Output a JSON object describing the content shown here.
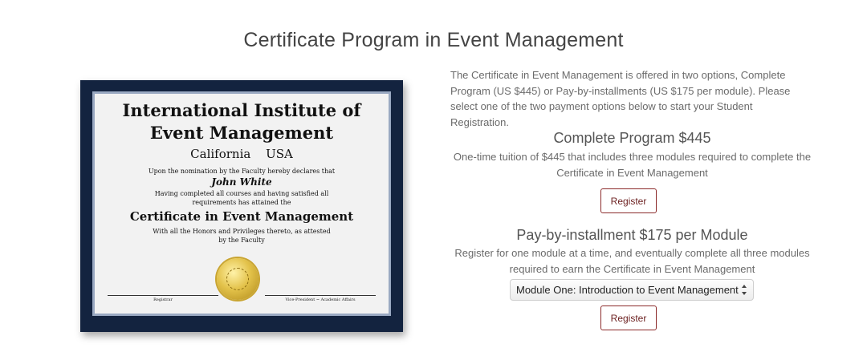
{
  "page": {
    "title": "Certificate Program in Event Management"
  },
  "certificate": {
    "institute_line1": "International Institute of",
    "institute_line2": "Event Management",
    "location": "California USA",
    "line1": "Upon the nomination by the Faculty hereby declares that",
    "recipient": "John White",
    "line2": "Having completed all courses and having satisfied all",
    "line3": "requirements has attained the",
    "award": "Certificate in Event Management",
    "line4": "With all the Honors and Privileges thereto, as attested",
    "line5": "by the Faculty",
    "sig_left": "Registrar",
    "sig_right": "Vice-President ~ Academic Affairs"
  },
  "intro": "The Certificate in Event Management is offered in two options, Complete Program (US $445) or Pay-by-installments (US $175 per module). Please select one of the two payment options below to start your Student Registration.",
  "option_complete": {
    "title": "Complete Program $445",
    "description": "One-time tuition of $445 that includes three modules required to complete the Certificate in Event Management",
    "button_label": "Register"
  },
  "option_installment": {
    "title": "Pay-by-installment $175 per Module",
    "description": "Register for one module at a time, and eventually complete all three modules required to earn the Certificate in Event Management",
    "module_select_value": "Module One: Introduction to Event Management",
    "button_label": "Register"
  },
  "colors": {
    "frame": "#13233f",
    "button_border": "#8b2a2a"
  }
}
